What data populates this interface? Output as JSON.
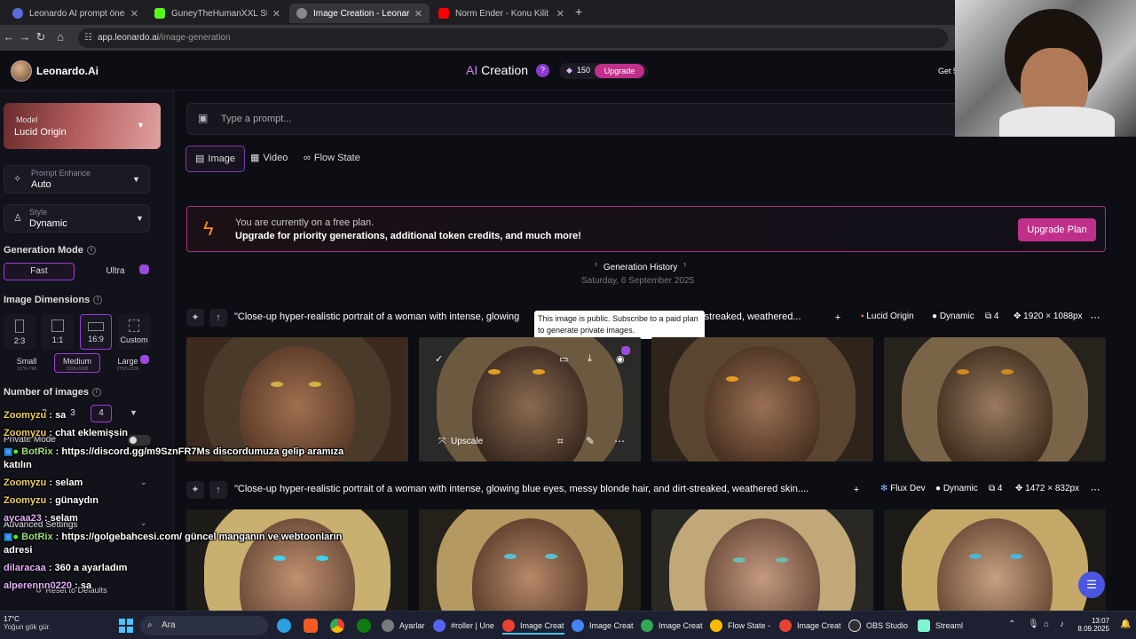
{
  "browser": {
    "tabs": [
      {
        "label": "Leonardo AI prompt önerisi",
        "color": "#5b6bd8",
        "active": false
      },
      {
        "label": "GuneyTheHumanXXL Stream -",
        "color": "#53fc18",
        "active": false
      },
      {
        "label": "Image Creation - Leonardo.Ai",
        "color": "#888888",
        "active": true
      },
      {
        "label": "Norm Ender - Konu Kilit - Y",
        "color": "#ff0000",
        "active": false
      }
    ],
    "new_tab": "+",
    "url_host": "app.leonardo.ai",
    "url_path": "/image-generation"
  },
  "header": {
    "brand": "Leonardo.Ai",
    "ai": "AI",
    "title": "Creation",
    "help": "?",
    "tokens": "150",
    "upgrade": "Upgrade",
    "get_more": "Get 5"
  },
  "sidebar": {
    "model_label": "Model",
    "model_value": "Lucid Origin",
    "prompt_enhance_label": "Prompt Enhance",
    "prompt_enhance_value": "Auto",
    "style_label": "Style",
    "style_value": "Dynamic",
    "generation_mode_title": "Generation Mode",
    "mode_fast": "Fast",
    "mode_ultra": "Ultra",
    "image_dimensions_title": "Image Dimensions",
    "dims": [
      {
        "label": "2:3",
        "selected": false
      },
      {
        "label": "1:1",
        "selected": false
      },
      {
        "label": "16:9",
        "selected": true
      },
      {
        "label": "Custom",
        "selected": false
      }
    ],
    "size_small": "Small",
    "size_small_sub": "1376×768",
    "size_medium": "Medium",
    "size_medium_sub": "1920×1088",
    "size_large": "Large",
    "size_large_sub": "2752×1536",
    "number_of_images_title": "Number of images",
    "counts": [
      "2",
      "3",
      "4"
    ],
    "count_selected": "4",
    "private_mode": "Private Mode",
    "advanced_settings": "Advanced Settings",
    "reset": "Reset to Defaults"
  },
  "main": {
    "prompt_placeholder": "Type a prompt...",
    "tabs": {
      "image": "Image",
      "video": "Video",
      "flow_state": "Flow State"
    },
    "banner_line1": "You are currently on a free plan.",
    "banner_line2": "Upgrade for priority generations, additional token credits, and much more!",
    "banner_button": "Upgrade Plan",
    "history_title": "Generation History",
    "history_date": "Saturday, 6 September 2025",
    "tooltip": "This image is public. Subscribe to a paid plan to generate private images.",
    "rows": [
      {
        "prompt_start": "\"Close-up hyper-realistic portrait of a woman with intense, glowing",
        "prompt_end": "-streaked, weathered...",
        "model": "Lucid Origin",
        "style": "Dynamic",
        "count": "4",
        "size": "1920 × 1088px"
      },
      {
        "prompt": "\"Close-up hyper-realistic portrait of a woman with intense, glowing blue eyes, messy blonde hair, and dirt-streaked, weathered skin....",
        "model": "Flux Dev",
        "style": "Dynamic",
        "count": "4",
        "size": "1472 × 832px"
      }
    ],
    "upscale": "Upscale"
  },
  "chat": [
    {
      "user": "Zoomyzu",
      "text": ": sa"
    },
    {
      "user": "Zoomyzu",
      "text": ": chat eklemişsin"
    },
    {
      "user": "BotRix",
      "text": ": https://discord.gg/m9SznFR7Ms discordumuza gelip aramıza"
    },
    {
      "user": "",
      "text": "katılın"
    },
    {
      "user": "Zoomyzu",
      "text": ": selam"
    },
    {
      "user": "Zoomyzu",
      "text": ": günaydın"
    },
    {
      "user": "aycaa23",
      "text": ": selam"
    },
    {
      "user": "BotRix",
      "text": ": https://golgebahcesi.com/ güncel manganın ve webtoonların"
    },
    {
      "user": "",
      "text": "adresi"
    },
    {
      "user": "dilaracaa",
      "text": ": 360 a ayarladım"
    },
    {
      "user": "alperennn0220",
      "text": ": sa"
    }
  ],
  "taskbar": {
    "weather_temp": "17°C",
    "weather_text": "Yoğun gök gür.",
    "search": "Ara",
    "apps": [
      {
        "label": "Ayarlar",
        "color": "#7a7a7a"
      },
      {
        "label": "#roller | Une",
        "color": "#5865f2"
      },
      {
        "label": "Image Creat",
        "color": "#e94235"
      },
      {
        "label": "Image Creat",
        "color": "#4285f4"
      },
      {
        "label": "Image Creat",
        "color": "#34a853"
      },
      {
        "label": "Flow State -",
        "color": "#fbbc05"
      },
      {
        "label": "Image Creat",
        "color": "#e94235"
      },
      {
        "label": "OBS Studio",
        "color": "#302e31"
      },
      {
        "label": "Streaml",
        "color": "#80f5d2"
      }
    ],
    "time": "13:07",
    "date": "8.09.2025"
  },
  "colors": {
    "accent": "#a03ad8",
    "upgrade_pink": "#c0308a",
    "banner_border": "#b0307a",
    "bolt": "#ff8a1e"
  }
}
